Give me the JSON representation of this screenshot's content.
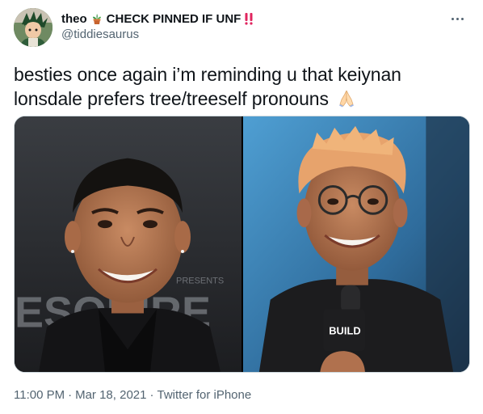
{
  "author": {
    "display_name": "theo",
    "flair_text": "CHECK PINNED IF UNF",
    "handle": "@tiddiesaurus"
  },
  "tweet": {
    "text": "besties once again i’m reminding u that keiynan lonsdale prefers tree/treeself pronouns"
  },
  "media": {
    "left_photo_backdrop_text": "ESQUIRE",
    "left_photo_small_text": "PRESENTS",
    "right_photo_mic_flag": "BUILD"
  },
  "meta": {
    "time": "11:00 PM",
    "separator": "·",
    "date": "Mar 18, 2021",
    "source": "Twitter for iPhone"
  },
  "colors": {
    "text_primary": "#0f1419",
    "text_secondary": "#536471",
    "media_border": "#cfd9de",
    "alert_red": "#e0245e"
  },
  "icons": {
    "emoji_1": "potted-plant-icon",
    "emoji_2": "double-exclamation-icon",
    "emoji_3": "folded-hands-icon",
    "more": "more-options-icon"
  }
}
